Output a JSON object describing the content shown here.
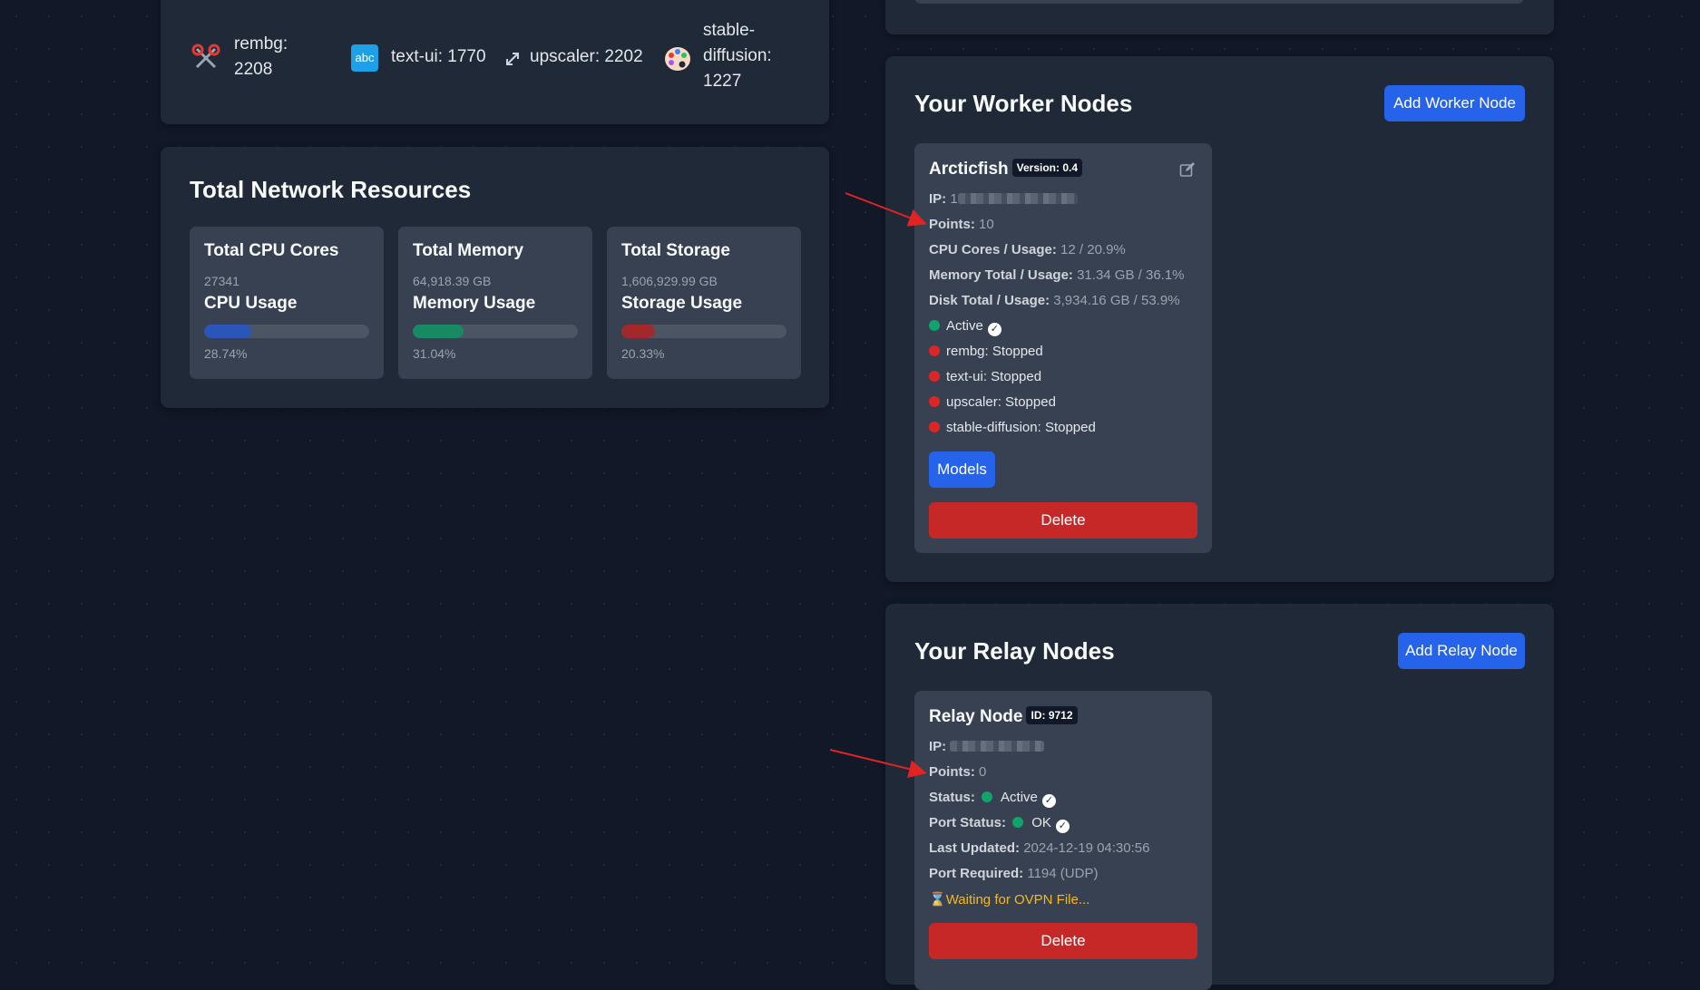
{
  "model_counts": [
    {
      "icon": "scissors-icon",
      "label": "rembg: 2208",
      "line1": "rembg:",
      "line2": "2208"
    },
    {
      "icon": "abc-icon",
      "icon_text": "abc",
      "label": "text-ui: 1770"
    },
    {
      "icon": "expand-arrows-icon",
      "label": "upscaler: 2202"
    },
    {
      "icon": "palette-icon",
      "line1": "stable-",
      "line2": "diffusion:",
      "line3": "1227"
    }
  ],
  "network": {
    "title": "Total Network Resources",
    "cards": [
      {
        "title": "Total CPU Cores",
        "value": "27341",
        "usage_label": "CPU Usage",
        "percent": 28.74,
        "percent_text": "28.74%",
        "color": "#2b55b8"
      },
      {
        "title": "Total Memory",
        "value": "64,918.39 GB",
        "usage_label": "Memory Usage",
        "percent": 31.04,
        "percent_text": "31.04%",
        "color": "#178a63"
      },
      {
        "title": "Total Storage",
        "value": "1,606,929.99 GB",
        "usage_label": "Storage Usage",
        "percent": 20.33,
        "percent_text": "20.33%",
        "color": "#a3282c"
      }
    ]
  },
  "workers": {
    "title": "Your Worker Nodes",
    "add_button": "Add Worker Node",
    "node": {
      "name": "Arcticfish",
      "version": "Version: 0.4",
      "ip_label": "IP:",
      "ip_value": "1",
      "points_label": "Points:",
      "points": "10",
      "cpu_label": "CPU Cores / Usage:",
      "cpu": "12 / 20.9%",
      "mem_label": "Memory Total / Usage:",
      "mem": "31.34 GB / 36.1%",
      "disk_label": "Disk Total / Usage:",
      "disk": "3,934.16 GB / 53.9%",
      "status": "Active",
      "services": [
        "rembg: Stopped",
        "text-ui: Stopped",
        "upscaler: Stopped",
        "stable-diffusion: Stopped"
      ],
      "models_button": "Models",
      "delete_button": "Delete"
    }
  },
  "relays": {
    "title": "Your Relay Nodes",
    "add_button": "Add Relay Node",
    "node": {
      "name": "Relay Node",
      "id": "ID: 9712",
      "ip_label": "IP:",
      "points_label": "Points:",
      "points": "0",
      "status_label": "Status:",
      "status": "Active",
      "port_status_label": "Port Status:",
      "port_status": "OK",
      "updated_label": "Last Updated:",
      "updated": "2024-12-19 04:30:56",
      "port_label": "Port Required:",
      "port": "1194 (UDP)",
      "waiting": "Waiting for OVPN File...",
      "delete_button": "Delete"
    }
  },
  "colors": {
    "bg": "#111827",
    "panel": "#1f2937",
    "card": "#374151",
    "blue": "#2563eb",
    "red": "#c62828",
    "green": "#10a36b",
    "warning": "#f5b91f",
    "arrow": "#e02424"
  }
}
